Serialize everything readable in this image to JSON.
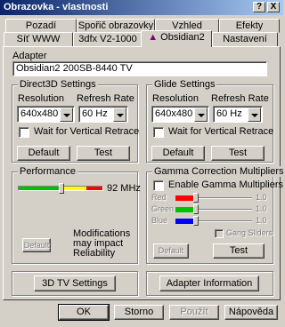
{
  "window": {
    "title": "Obrazovka - vlastnosti"
  },
  "titlebar_buttons": {
    "help": "?",
    "close": "X"
  },
  "tabs_back": [
    "Pozadí",
    "Spořič obrazovky",
    "Vzhled",
    "Efekty"
  ],
  "tabs_front": [
    "Síť WWW",
    "3dfx V2-1000",
    "Obsidian2",
    "Nastavení"
  ],
  "adapter": {
    "label": "Adapter",
    "value": "Obsidian2 200SB-8440 TV"
  },
  "direct3d": {
    "title": "Direct3D Settings",
    "resolution_label": "Resolution",
    "refresh_label": "Refresh Rate",
    "resolution_value": "640x480",
    "refresh_value": "60 Hz",
    "vsync_label": "Wait for Vertical Retrace",
    "default_label": "Default",
    "test_label": "Test"
  },
  "glide": {
    "title": "Glide Settings",
    "resolution_label": "Resolution",
    "refresh_label": "Refresh Rate",
    "resolution_value": "640x480",
    "refresh_value": "60 Hz",
    "vsync_label": "Wait for Vertical Retrace",
    "default_label": "Default",
    "test_label": "Test"
  },
  "performance": {
    "title": "Performance",
    "value": "92 MHz",
    "default_label": "Default",
    "note": "Modifications may impact Reliability"
  },
  "gamma": {
    "title": "Gamma Correction Multipliers",
    "enable_label": "Enable Gamma Multipliers",
    "channels": [
      {
        "name": "Red",
        "value": "1.0",
        "color": "#ff0000"
      },
      {
        "name": "Green",
        "value": "1.0",
        "color": "#00c000"
      },
      {
        "name": "Blue",
        "value": "1.0",
        "color": "#0000ff"
      }
    ],
    "gang_label": "Gang Sliders",
    "default_label": "Default",
    "test_label": "Test"
  },
  "bottom": {
    "tv_label": "3D TV Settings",
    "adapter_info_label": "Adapter Information"
  },
  "dialog": {
    "ok": "OK",
    "cancel": "Storno",
    "apply": "Použít",
    "help": "Nápověda"
  }
}
